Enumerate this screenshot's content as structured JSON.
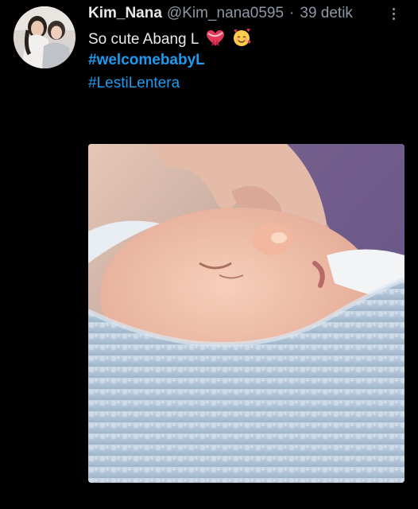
{
  "tweet": {
    "display_name": "Kim_Nana",
    "handle": "@Kim_nana0595",
    "separator": "·",
    "time": "39 detik",
    "text": "So cute Abang L",
    "emojis": [
      "heart-ribbon-icon",
      "smiling-face-with-hearts-icon"
    ],
    "hashtags": [
      "#welcomebabyL",
      "#LestiLentera"
    ]
  },
  "colors": {
    "background": "#000000",
    "primary_text": "#e7e9ea",
    "secondary_text": "#8b98a5",
    "link": "#1d9bf0"
  }
}
